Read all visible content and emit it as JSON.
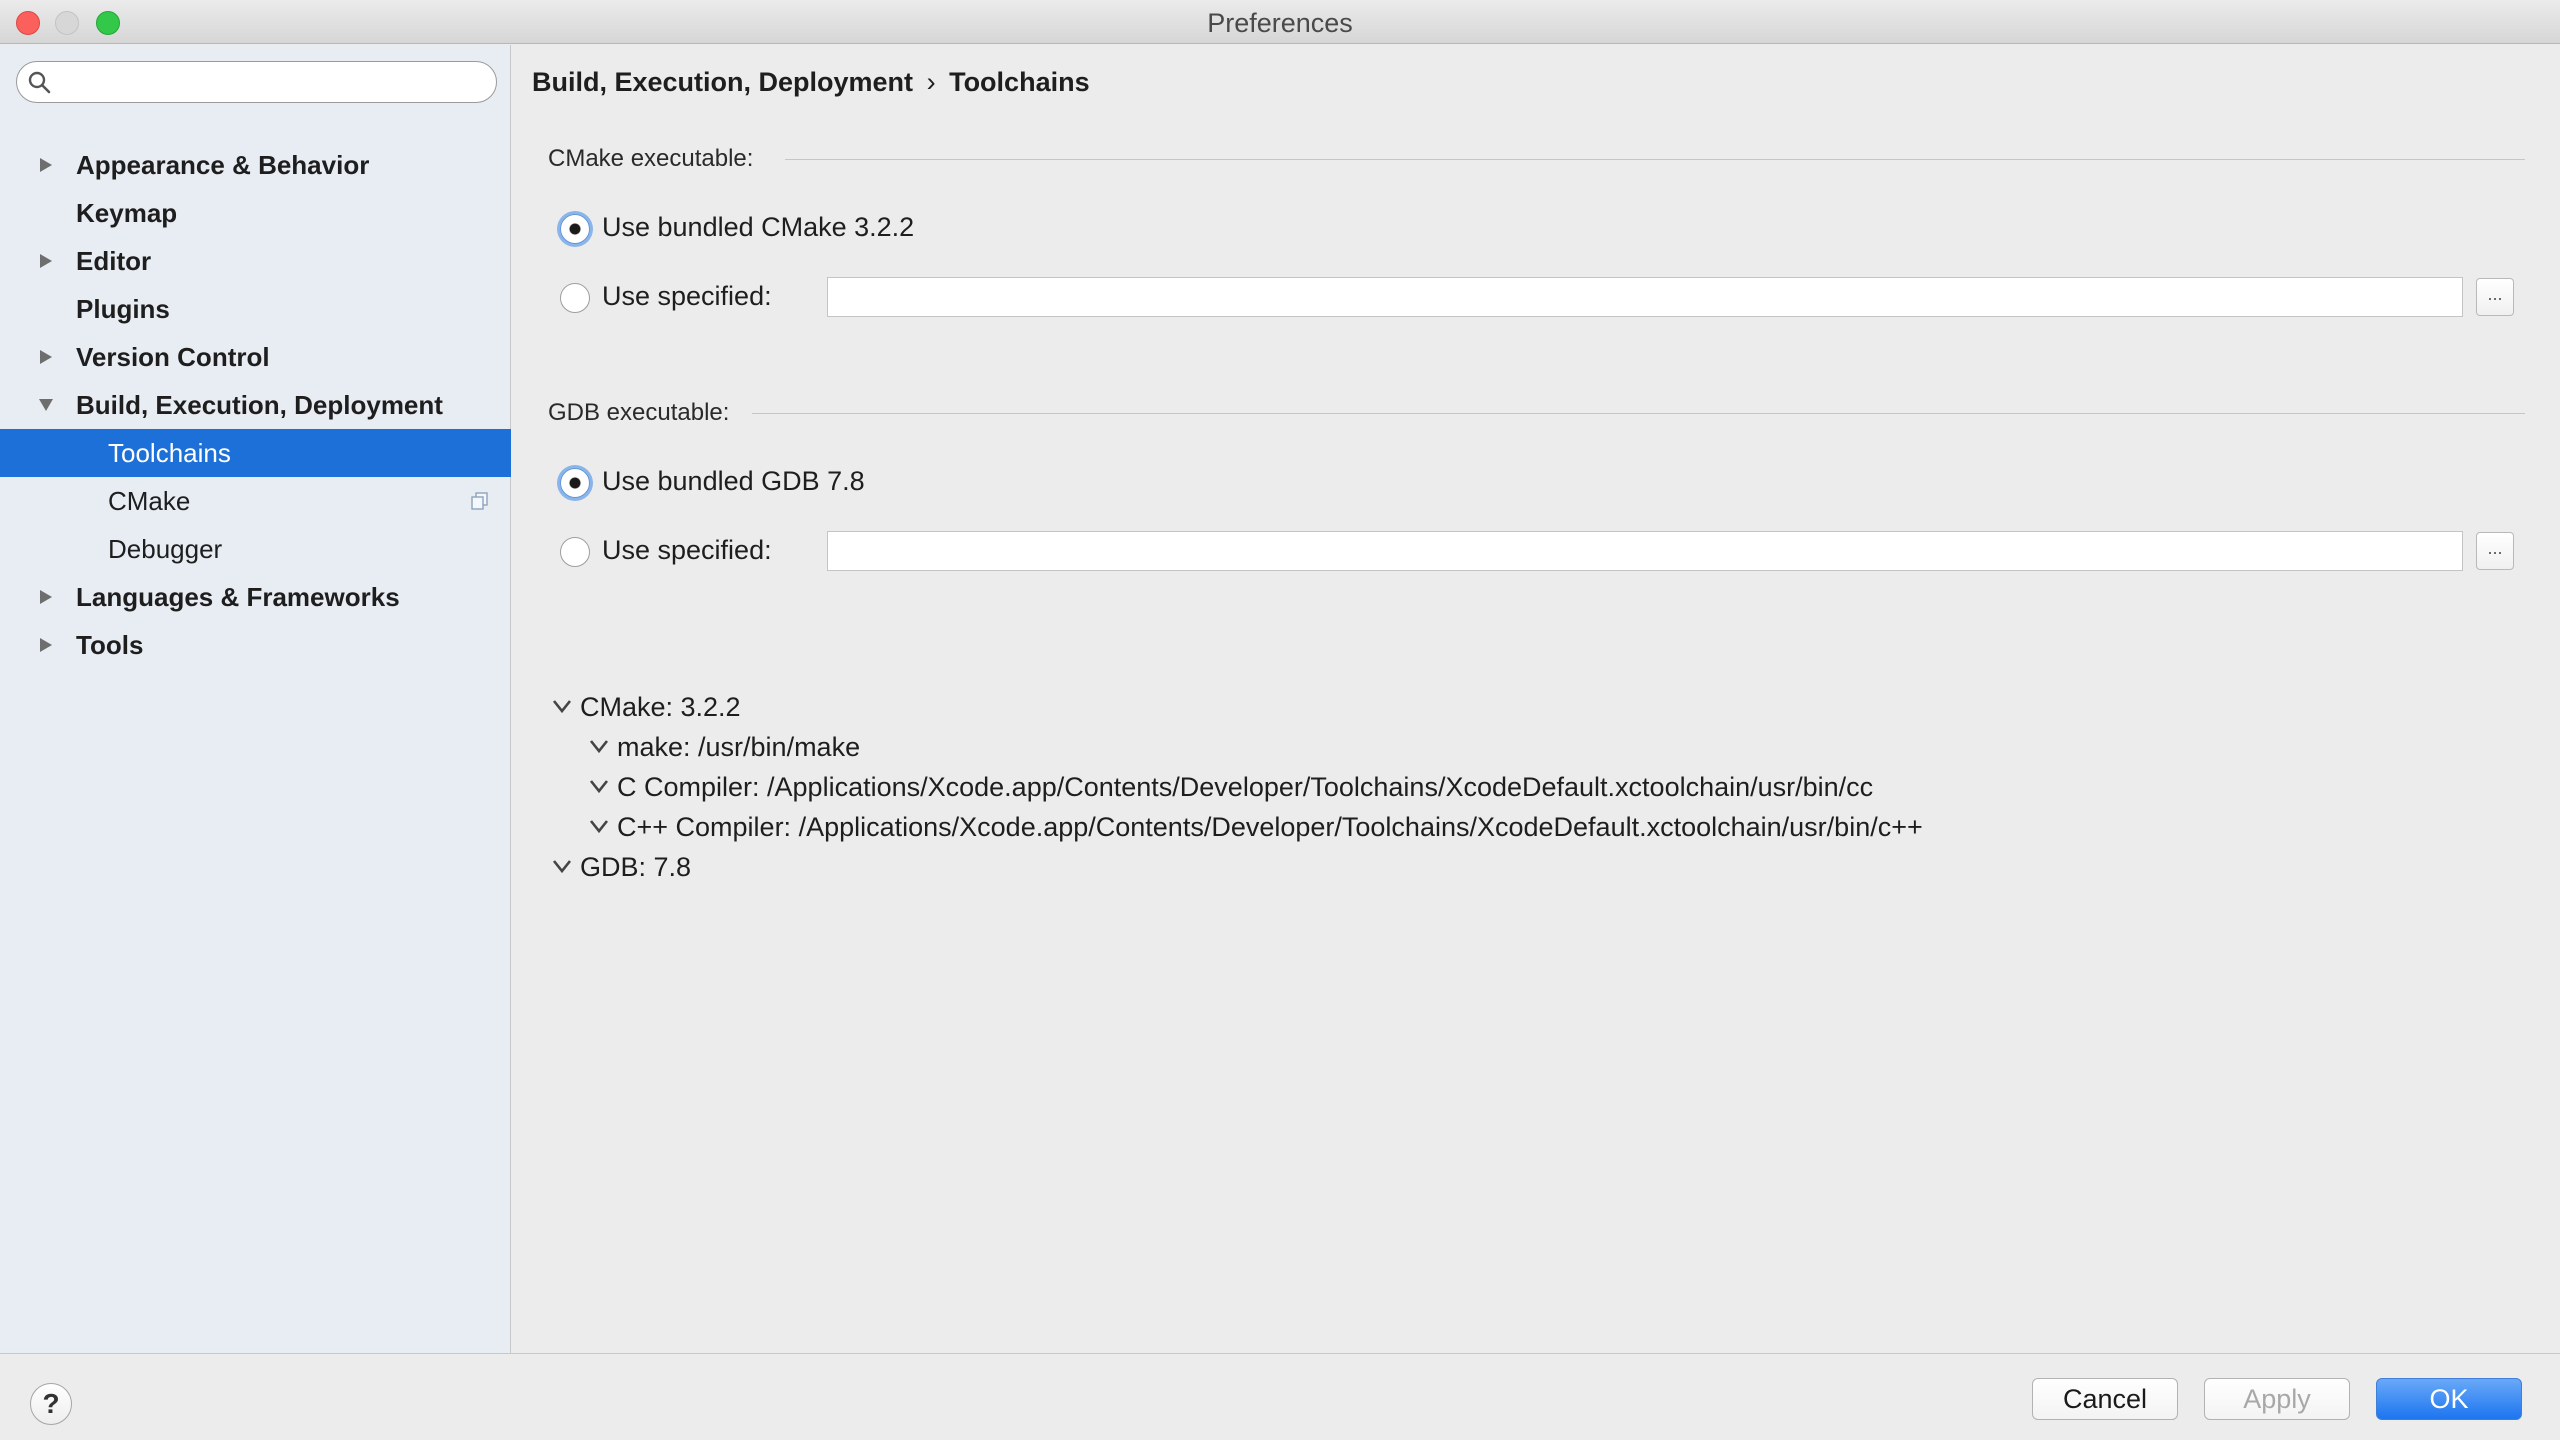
{
  "window": {
    "title": "Preferences"
  },
  "sidebar": {
    "search": {
      "value": "",
      "placeholder": ""
    },
    "items": [
      {
        "label": "Appearance & Behavior",
        "expandable": true,
        "expanded": false
      },
      {
        "label": "Keymap",
        "expandable": false
      },
      {
        "label": "Editor",
        "expandable": true,
        "expanded": false
      },
      {
        "label": "Plugins",
        "expandable": false
      },
      {
        "label": "Version Control",
        "expandable": true,
        "expanded": false
      },
      {
        "label": "Build, Execution, Deployment",
        "expandable": true,
        "expanded": true
      },
      {
        "label": "Toolchains",
        "child": true,
        "selected": true
      },
      {
        "label": "CMake",
        "child": true,
        "icon": "copy-icon"
      },
      {
        "label": "Debugger",
        "child": true
      },
      {
        "label": "Languages & Frameworks",
        "expandable": true,
        "expanded": false
      },
      {
        "label": "Tools",
        "expandable": true,
        "expanded": false
      }
    ]
  },
  "main": {
    "breadcrumb": {
      "parent": "Build, Execution, Deployment",
      "separator": "›",
      "current": "Toolchains"
    },
    "cmake": {
      "section_label": "CMake executable:",
      "bundled_label": "Use bundled CMake 3.2.2",
      "bundled_selected": true,
      "specified_label": "Use specified:",
      "specified_value": "",
      "browse_label": "..."
    },
    "gdb": {
      "section_label": "GDB executable:",
      "bundled_label": "Use bundled GDB 7.8",
      "bundled_selected": true,
      "specified_label": "Use specified:",
      "specified_value": "",
      "browse_label": "..."
    },
    "tree": {
      "cmake": "CMake: 3.2.2",
      "make": "make: /usr/bin/make",
      "c_compiler": "C Compiler: /Applications/Xcode.app/Contents/Developer/Toolchains/XcodeDefault.xctoolchain/usr/bin/cc",
      "cpp_compiler": "C++ Compiler: /Applications/Xcode.app/Contents/Developer/Toolchains/XcodeDefault.xctoolchain/usr/bin/c++",
      "gdb": "GDB: 7.8"
    }
  },
  "footer": {
    "help_label": "?",
    "cancel_label": "Cancel",
    "apply_label": "Apply",
    "ok_label": "OK"
  },
  "colors": {
    "selection": "#1d70d8",
    "sidebar_bg": "#e8edf3",
    "window_bg": "#ececec",
    "ok_button": "#1d75f0"
  }
}
